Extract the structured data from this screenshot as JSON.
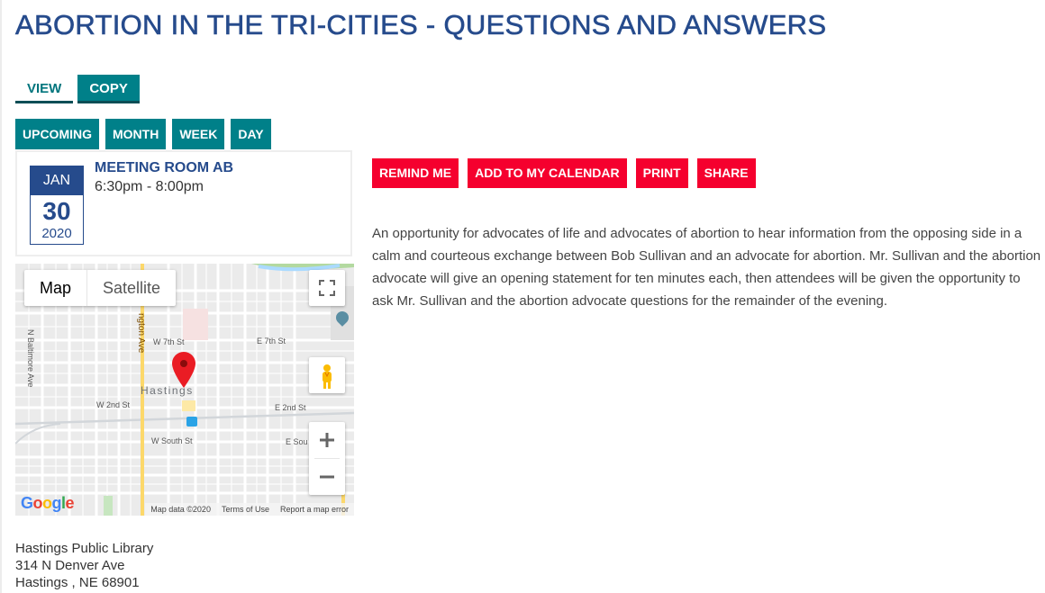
{
  "page": {
    "title": "ABORTION IN THE TRI-CITIES - QUESTIONS AND ANSWERS"
  },
  "tabs": [
    {
      "label": "VIEW",
      "active": true
    },
    {
      "label": "COPY",
      "active": false
    }
  ],
  "view_buttons": [
    "UPCOMING",
    "MONTH",
    "WEEK",
    "DAY"
  ],
  "event": {
    "month": "JAN",
    "day": "30",
    "year": "2020",
    "room": "MEETING ROOM AB",
    "time": "6:30pm - 8:00pm"
  },
  "actions": [
    "REMIND ME",
    "ADD TO MY CALENDAR",
    "PRINT",
    "SHARE"
  ],
  "description": "An opportunity for advocates of life and advocates of abortion to hear information from the opposing side in a calm and courteous exchange between Bob Sullivan and an advocate for abortion. Mr. Sullivan and the abortion advocate will give an opening statement for ten minutes each, then attendees will be given the opportunity to ask Mr. Sullivan and the abortion advocate questions for the remainder of the evening.",
  "map": {
    "type_buttons": {
      "map": "Map",
      "satellite": "Satellite"
    },
    "labels": {
      "n_baltimore": "N Baltimore Ave",
      "burlington": "ngton Ave",
      "w7th": "W 7th St",
      "e7th": "E 7th St",
      "hastings": "Hastings",
      "w2nd": "W 2nd St",
      "e2nd": "E 2nd St",
      "wsouth": "W South St",
      "esouth": "E Sou"
    },
    "logo": "Google",
    "attribution": {
      "data": "Map data ©2020",
      "terms": "Terms of Use",
      "report": "Report a map error"
    },
    "icons": {
      "fullscreen": "fullscreen-icon",
      "pegman": "pegman-icon",
      "zoom_in": "plus-icon",
      "zoom_out": "minus-icon",
      "marker": "map-pin-icon"
    }
  },
  "address": {
    "name": "Hastings Public Library",
    "street": "314 N Denver Ave",
    "city": "Hastings , NE 68901"
  },
  "colors": {
    "title_blue": "#264b8c",
    "teal": "#008089",
    "red": "#f5002e"
  }
}
